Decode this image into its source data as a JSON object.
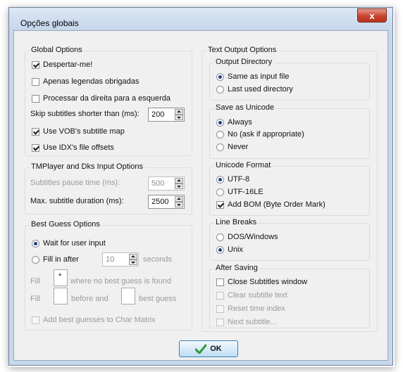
{
  "window": {
    "title": "Opções globais",
    "close_label": "x"
  },
  "global_options": {
    "title": "Global Options",
    "wake_me": "Despertar-me!",
    "forced_only": "Apenas legendas obrigadas",
    "rtl": "Processar da direita para a esquerda",
    "skip_label": "Skip subtitles shorter than (ms):",
    "skip_value": "200",
    "vob_map": "Use VOB's subtitle map",
    "idx_offsets": "Use IDX's file offsets"
  },
  "tmplayer": {
    "title": "TMPlayer and Dks Input Options",
    "pause_label": "Subtitles pause time (ms):",
    "pause_value": "500",
    "max_label": "Max. subtitle duration (ms):",
    "max_value": "2500"
  },
  "best_guess": {
    "title": "Best Guess Options",
    "wait": "Wait for user input",
    "fill_after": "Fill in after",
    "fill_after_value": "10",
    "seconds": "seconds",
    "fill1": "Fill",
    "fill1_value": "*",
    "where_none": "where no best guess is found",
    "fill2": "Fill",
    "before_and": "before and",
    "best_guess_label": "best guess",
    "add_to_matrix": "Add best guesses to Char Matrix"
  },
  "text_output": {
    "title": "Text Output Options",
    "output_directory": {
      "title": "Output Directory",
      "same": "Same as input file",
      "last": "Last used directory"
    },
    "save_unicode": {
      "title": "Save as Unicode",
      "always": "Always",
      "no": "No (ask if appropriate)",
      "never": "Never"
    },
    "unicode_format": {
      "title": "Unicode Format",
      "utf8": "UTF-8",
      "utf16": "UTF-16LE",
      "bom": "Add BOM (Byte Order Mark)"
    },
    "line_breaks": {
      "title": "Line Breaks",
      "dos": "DOS/Windows",
      "unix": "Unix"
    },
    "after_saving": {
      "title": "After Saving",
      "close": "Close Subtitles window",
      "clear": "Clear subtitle text",
      "reset": "Reset time index",
      "next": "Next subtitle..."
    }
  },
  "ok_label": "OK",
  "colors": {
    "frame": "#c8d8ec",
    "close": "#c9452f",
    "ok_check": "#2e9b2e"
  }
}
